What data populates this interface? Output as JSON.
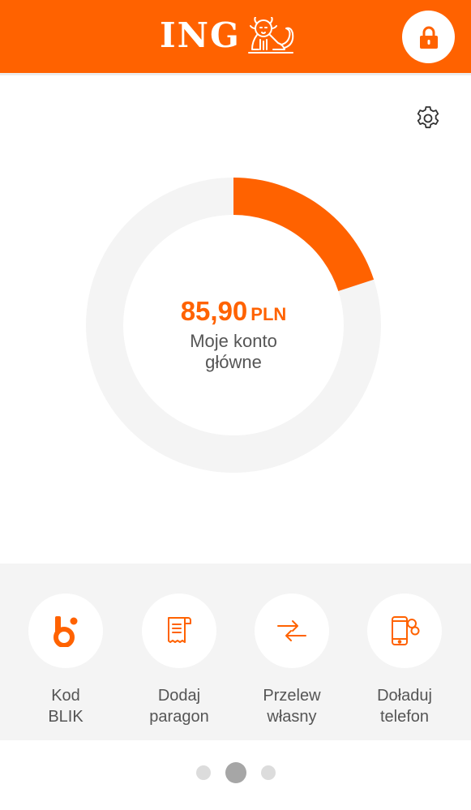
{
  "header": {
    "brand": "ING",
    "brand_color": "#ff6200",
    "logo_icon": "lion-icon",
    "lock_icon": "lock-icon"
  },
  "settings": {
    "icon": "gear-icon"
  },
  "account": {
    "amount": "85,90",
    "currency": "PLN",
    "name": "Moje konto\ngłówne",
    "chart_fill_fraction": 0.2
  },
  "actions": [
    {
      "line1": "Kod",
      "line2": "BLIK",
      "icon": "blik-icon"
    },
    {
      "line1": "Dodaj",
      "line2": "paragon",
      "icon": "receipt-icon"
    },
    {
      "line1": "Przelew",
      "line2": "własny",
      "icon": "transfer-arrows-icon"
    },
    {
      "line1": "Doładuj",
      "line2": "telefon",
      "icon": "phone-topup-icon"
    }
  ],
  "pagination": {
    "count": 3,
    "active_index": 1
  }
}
